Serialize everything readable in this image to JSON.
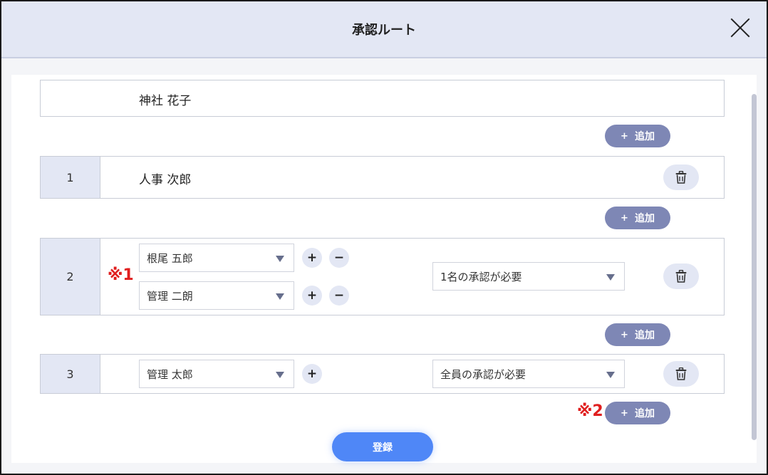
{
  "dialog": {
    "title": "承認ルート"
  },
  "colors": {
    "accent": "#4f87f7",
    "add_button": "#7e87b5",
    "header_bg": "#e3e7f4",
    "note_red": "#e01e1e"
  },
  "applicant": {
    "name": "神社 花子"
  },
  "add_button": {
    "plus": "+",
    "label": "追加"
  },
  "steps": [
    {
      "number": "1",
      "approvers": [
        {
          "name": "人事 次郎"
        }
      ]
    },
    {
      "number": "2",
      "approvers": [
        {
          "name": "根尾 五郎"
        },
        {
          "name": "管理 二朗"
        }
      ],
      "condition": "1名の承認が必要"
    },
    {
      "number": "3",
      "approvers": [
        {
          "name": "管理 太郎"
        }
      ],
      "condition": "全員の承認が必要"
    }
  ],
  "controls": {
    "plus": "+",
    "minus": "−"
  },
  "notes": {
    "note1": "※1",
    "note2": "※2"
  },
  "icons": {
    "close": "close-icon",
    "trash": "trash-icon",
    "dropdown": "chevron-down-icon"
  },
  "submit": {
    "label": "登録"
  }
}
